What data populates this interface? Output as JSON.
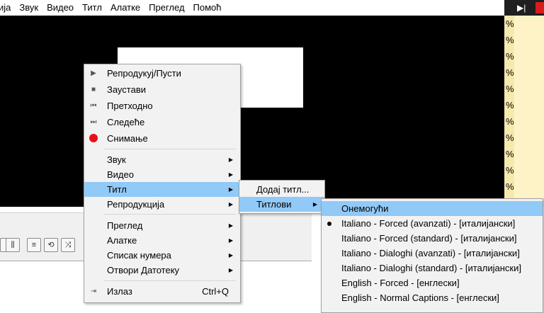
{
  "menubar": {
    "items": [
      "ија",
      "Звук",
      "Видео",
      "Титл",
      "Алатке",
      "Преглед",
      "Помоћ"
    ]
  },
  "right_panel": {
    "percent_marks": [
      "%",
      "%",
      "%",
      "%",
      "%",
      "%",
      "%",
      "%",
      "%",
      "%",
      "%"
    ]
  },
  "main_menu": {
    "items": [
      {
        "label": "Репродукуј/Пусти",
        "icon": "play-icon"
      },
      {
        "label": "Заустави",
        "icon": "stop-icon"
      },
      {
        "label": "Претходно",
        "icon": "previous-icon"
      },
      {
        "label": "Следеће",
        "icon": "next-icon"
      },
      {
        "label": "Снимање",
        "icon": "record-icon",
        "icon_color": "#e8111a"
      },
      {
        "label": "Звук",
        "submenu": true
      },
      {
        "label": "Видео",
        "submenu": true
      },
      {
        "label": "Титл",
        "submenu": true,
        "highlighted": true
      },
      {
        "label": "Репродукција",
        "submenu": true
      },
      {
        "label": "Преглед",
        "submenu": true
      },
      {
        "label": "Алатке",
        "submenu": true
      },
      {
        "label": "Списак нумера",
        "submenu": true
      },
      {
        "label": "Отвори Датотеку",
        "submenu": true
      },
      {
        "label": "Излаз",
        "icon": "exit-icon",
        "shortcut": "Ctrl+Q"
      }
    ]
  },
  "subtitle_menu": {
    "items": [
      {
        "label": "Додај титл..."
      },
      {
        "label": "Титлови",
        "submenu": true,
        "highlighted": true
      }
    ]
  },
  "tracks_menu": {
    "items": [
      {
        "label": "Онемогући",
        "highlighted": true
      },
      {
        "label": "Italiano - Forced (avanzati) - [италијански]",
        "selected": true
      },
      {
        "label": "Italiano - Forced (standard) - [италијански]"
      },
      {
        "label": "Italiano - Dialoghi (avanzati) - [италијански]"
      },
      {
        "label": "Italiano - Dialoghi (standard) - [италијански]"
      },
      {
        "label": "English - Forced - [енглески]"
      },
      {
        "label": "English - Normal Captions - [енглески]"
      }
    ]
  },
  "colors": {
    "highlight": "#91c9f7",
    "record": "#e8111a",
    "menu_bg": "#f2f2f2"
  }
}
